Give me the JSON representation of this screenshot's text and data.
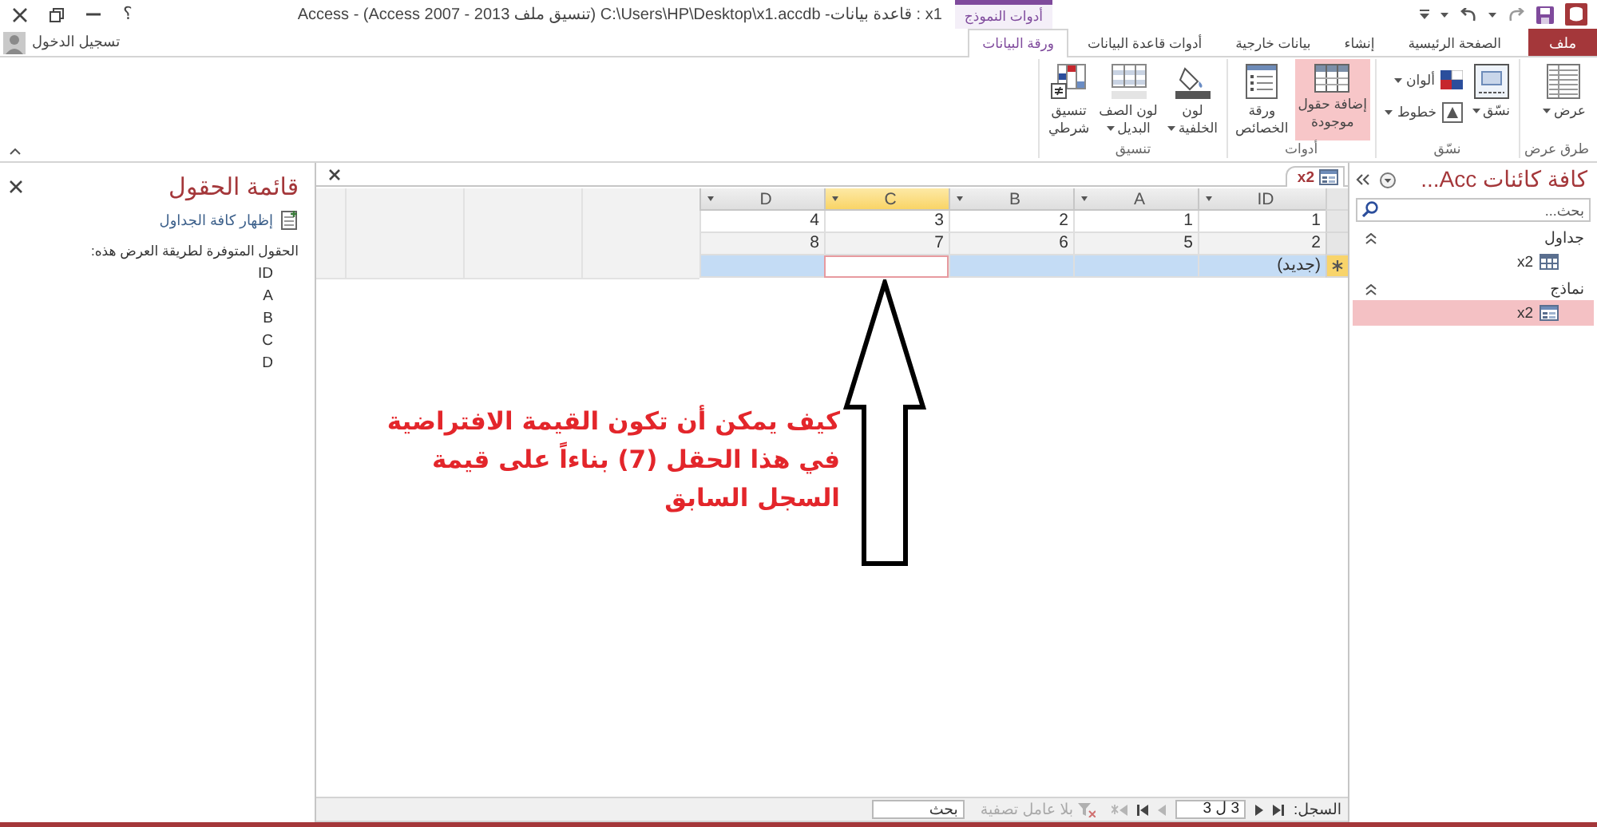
{
  "title_bar": {
    "title": "x1 : قاعدة بيانات- C:\\Users\\HP\\Desktop\\x1.accdb (تنسيق ملف Access 2007 - 2013) - Access",
    "contextual_tab_group": "أدوات النموذج",
    "help": "؟"
  },
  "ribbon_tabs": [
    {
      "label": "ملف",
      "kind": "file",
      "selected": false
    },
    {
      "label": "الصفحة الرئيسية",
      "kind": "standard",
      "selected": false
    },
    {
      "label": "إنشاء",
      "kind": "standard",
      "selected": false
    },
    {
      "label": "بيانات خارجية",
      "kind": "standard",
      "selected": false
    },
    {
      "label": "أدوات قاعدة البيانات",
      "kind": "standard",
      "selected": false
    },
    {
      "label": "ورقة البيانات",
      "kind": "contextual",
      "selected": true
    }
  ],
  "sign_in": "تسجيل الدخول",
  "ribbon_groups": [
    {
      "label": "طرق عرض",
      "commands": [
        {
          "label": "عرض",
          "kind": "large",
          "dropdown": true,
          "on": false
        }
      ]
    },
    {
      "label": "نسّق",
      "commands": [
        {
          "label": "نسّق",
          "kind": "large",
          "dropdown": true,
          "on": false
        },
        {
          "label": "ألوان",
          "kind": "small",
          "dropdown": true,
          "on": false
        },
        {
          "label": "خطوط",
          "kind": "small",
          "dropdown": true,
          "on": false
        }
      ]
    },
    {
      "label": "أدوات",
      "commands": [
        {
          "label": "إضافة حقول\nموجودة",
          "kind": "large",
          "dropdown": false,
          "on": true
        },
        {
          "label": "ورقة\nالخصائص",
          "kind": "large",
          "dropdown": false,
          "on": false
        }
      ]
    },
    {
      "label": "تنسيق",
      "commands": [
        {
          "label": "لون\nالخلفية",
          "kind": "large",
          "dropdown": true,
          "on": false
        },
        {
          "label": "لون الصف\nالبديل",
          "kind": "large",
          "dropdown": true,
          "on": false
        },
        {
          "label": "تنسيق\nشرطي",
          "kind": "large",
          "dropdown": false,
          "on": false
        }
      ]
    }
  ],
  "navigation_pane": {
    "title": "كافة كائنات Acc...",
    "search_placeholder": "بحث...",
    "groups": [
      {
        "label": "جداول",
        "expanded": true,
        "items": [
          {
            "label": "x2",
            "kind": "table",
            "selected": false
          }
        ]
      },
      {
        "label": "نماذج",
        "expanded": true,
        "items": [
          {
            "label": "x2",
            "kind": "form",
            "selected": true
          }
        ]
      }
    ]
  },
  "document": {
    "tab": "x2",
    "datasheet": {
      "columns": [
        {
          "label": "ID",
          "selected": false
        },
        {
          "label": "A",
          "selected": false
        },
        {
          "label": "B",
          "selected": false
        },
        {
          "label": "C",
          "selected": true
        },
        {
          "label": "D",
          "selected": false
        }
      ],
      "rows": [
        {
          "current": false,
          "cells": [
            "1",
            "1",
            "2",
            "3",
            "4"
          ]
        },
        {
          "current": false,
          "cells": [
            "2",
            "5",
            "6",
            "7",
            "8"
          ]
        }
      ],
      "new_row": {
        "current": true,
        "label": "(جديد)",
        "cells": [
          {
            "selected": false
          },
          {
            "selected": false
          },
          {
            "selected": false
          },
          {
            "selected": true
          },
          {
            "selected": false
          }
        ]
      }
    },
    "annotation": "كيف يمكن أن تكون القيمة الافتراضية\nفي هذا الحقل (7) بناءاً على قيمة\nالسجل السابق",
    "record_navigator": {
      "label": "السجل:",
      "position": "3 ل 3",
      "buttons": [
        {
          "kind": "first",
          "disabled": false
        },
        {
          "kind": "previous",
          "disabled": false
        },
        {
          "kind": "next",
          "disabled": true
        },
        {
          "kind": "last",
          "disabled": false
        },
        {
          "kind": "new",
          "disabled": true
        }
      ],
      "filter": {
        "label": "بلا عامل تصفية",
        "disabled": true
      },
      "search_placeholder": "بحث"
    }
  },
  "field_list": {
    "title": "قائمة الحقول",
    "show_all_tables": "إظهار كافة الجداول",
    "caption": "الحقول المتوفرة لطريقة العرض هذه:",
    "fields": [
      "ID",
      "A",
      "B",
      "C",
      "D"
    ]
  }
}
